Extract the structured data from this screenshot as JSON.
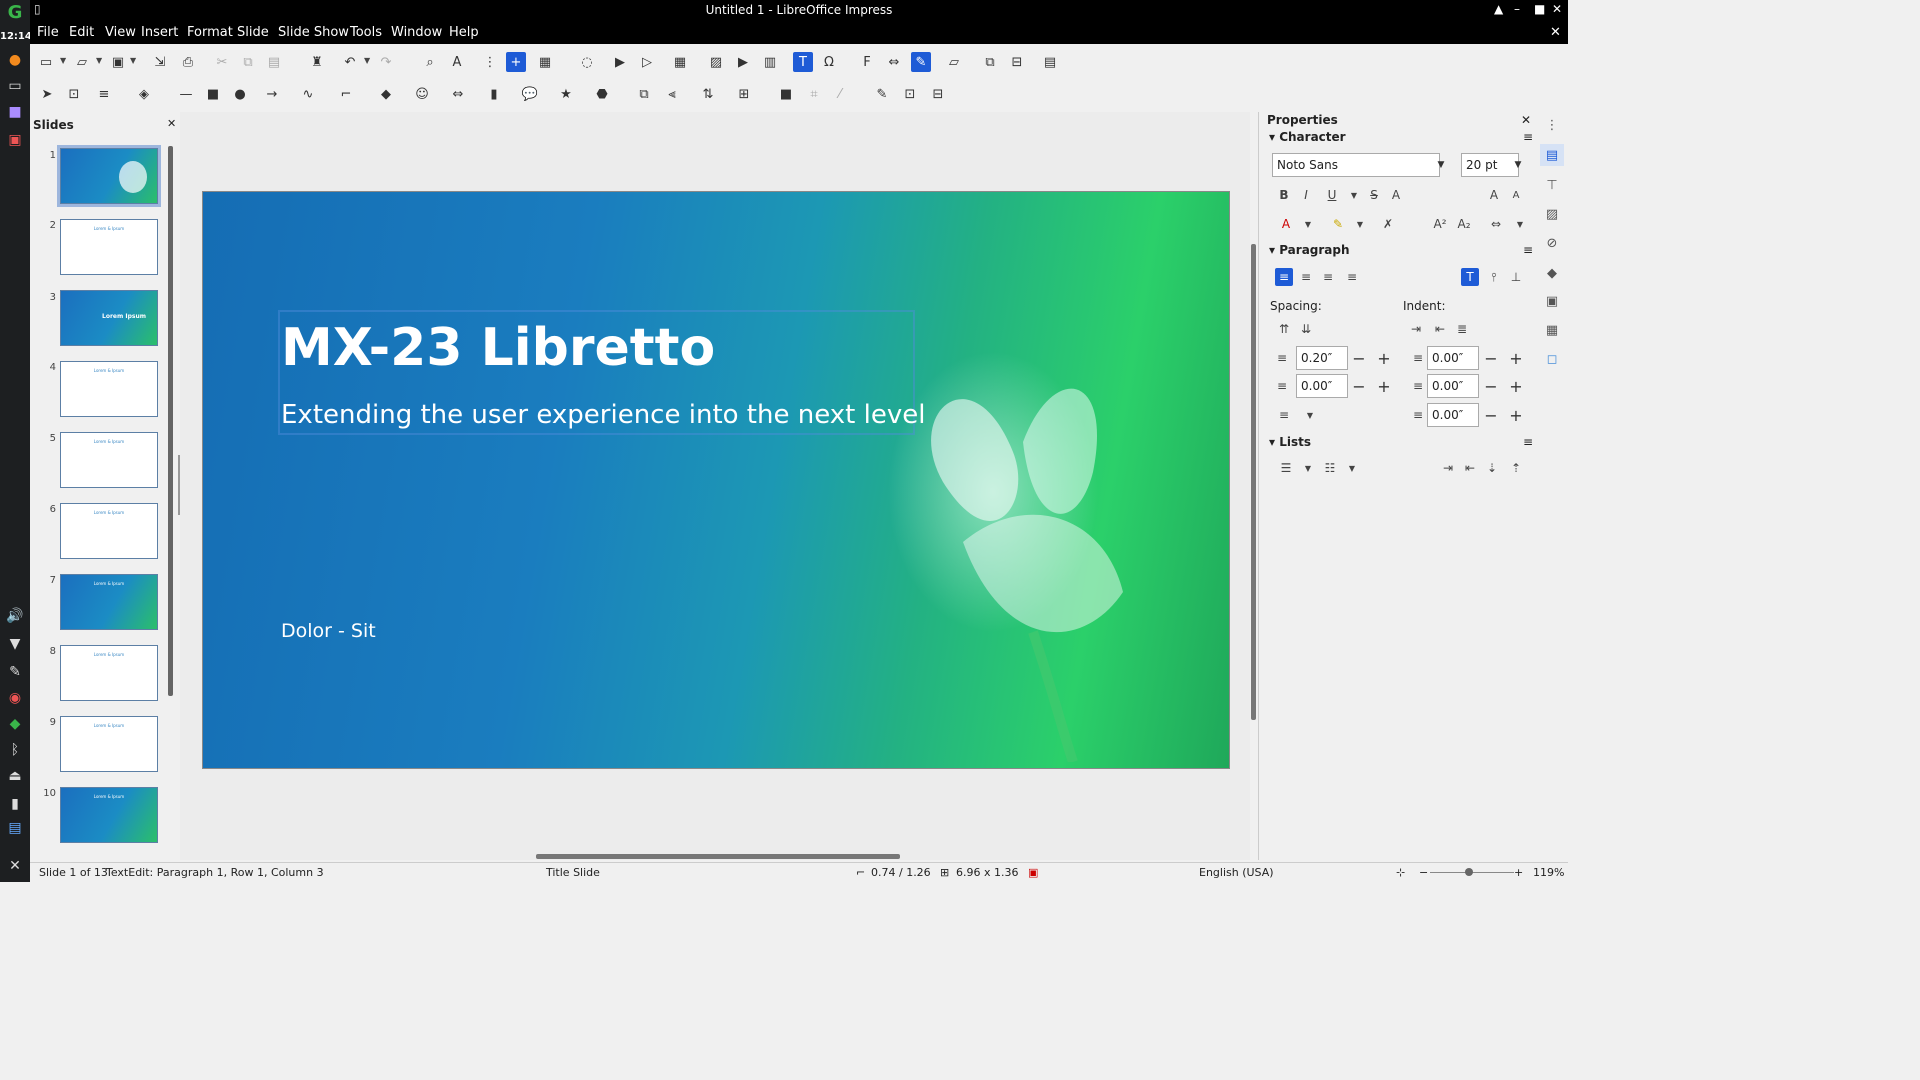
{
  "window": {
    "title": "Untitled 1 - LibreOffice Impress"
  },
  "system": {
    "clock": "12:14"
  },
  "menu": [
    "File",
    "Edit",
    "View",
    "Insert",
    "Format",
    "Slide",
    "Slide Show",
    "Tools",
    "Window",
    "Help"
  ],
  "slides_pane": {
    "title": "Slides",
    "numbers": [
      "1",
      "2",
      "3",
      "4",
      "5",
      "6",
      "7",
      "8",
      "9",
      "10"
    ],
    "thumb_labels": [
      "",
      "Lorem & Ipsum",
      "Lorem Ipsum",
      "Lorem & Ipsum",
      "Lorem & Ipsum",
      "Lorem & Ipsum",
      "Lorem & Ipsum",
      "Lorem & Ipsum",
      "Lorem & Ipsum",
      "Lorem & Ipsum"
    ]
  },
  "slide": {
    "title": "MX-23 Libretto",
    "subtitle": "Extending the user experience into the next level",
    "footer": "Dolor - Sit"
  },
  "properties": {
    "title": "Properties",
    "character": {
      "label": "Character",
      "font": "Noto Sans",
      "size": "20 pt"
    },
    "paragraph": {
      "label": "Paragraph",
      "spacing_label": "Spacing:",
      "indent_label": "Indent:",
      "spacing_above": "0.20″",
      "spacing_below": "0.00″",
      "indent_before": "0.00″",
      "indent_after": "0.00″",
      "indent_first": "0.00″"
    },
    "lists": {
      "label": "Lists"
    }
  },
  "status": {
    "slide": "Slide 1 of 13",
    "edit": "TextEdit: Paragraph 1, Row 1, Column 3",
    "layout": "Title Slide",
    "position": "0.74 / 1.26",
    "size": "6.96 x 1.36",
    "language": "English (USA)",
    "zoom": "119%"
  },
  "colors": {
    "accent": "#1e5bd6",
    "titlebar": "#000000"
  }
}
